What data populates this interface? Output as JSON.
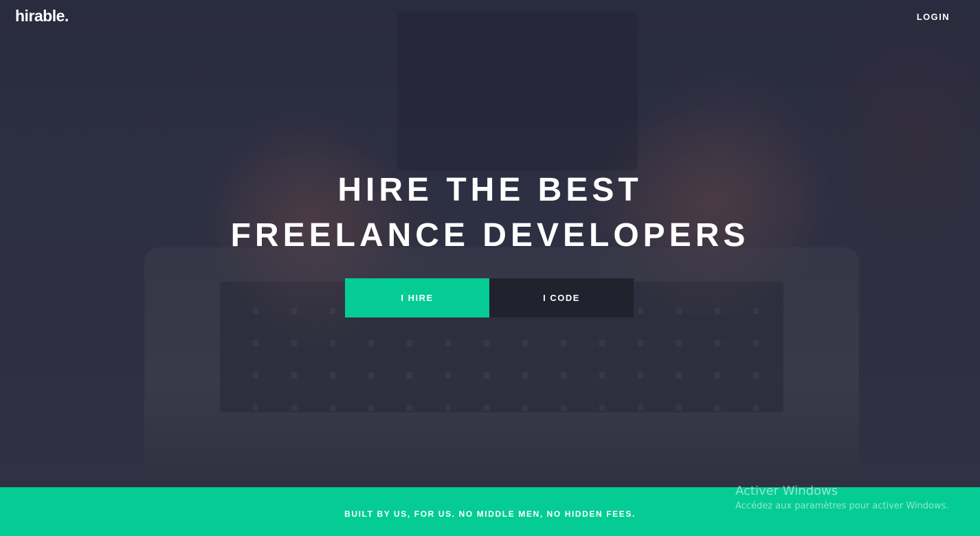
{
  "brand": {
    "logo_text": "hirable."
  },
  "nav": {
    "login_label": "LOGIN"
  },
  "hero": {
    "headline_line1": "HIRE THE BEST",
    "headline_line2": "FREELANCE DEVELOPERS",
    "hire_button": "I HIRE",
    "code_button": "I CODE"
  },
  "footer": {
    "tagline": "BUILT BY US, FOR US. NO MIDDLE MEN, NO HIDDEN FEES."
  },
  "os_watermark": {
    "title": "Activer Windows",
    "subtitle": "Accédez aux paramètres pour activer Windows."
  },
  "colors": {
    "accent": "#05cc94",
    "dark_button": "#20222e",
    "overlay": "#2c2d42"
  }
}
